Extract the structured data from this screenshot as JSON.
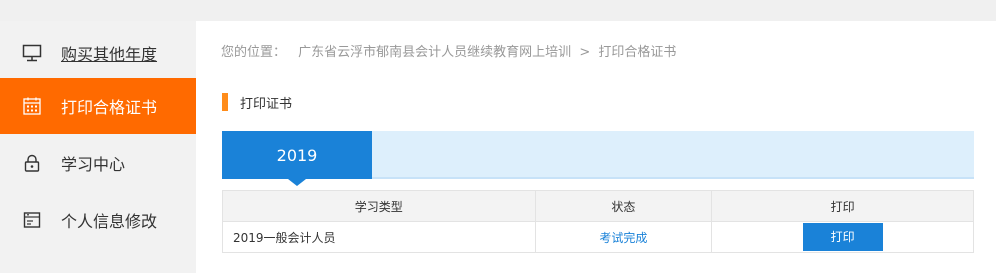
{
  "sidebar": {
    "items": [
      {
        "label": "购买其他年度",
        "icon": "monitor-icon"
      },
      {
        "label": "打印合格证书",
        "icon": "calendar-icon"
      },
      {
        "label": "学习中心",
        "icon": "lock-icon"
      },
      {
        "label": "个人信息修改",
        "icon": "id-card-icon"
      }
    ]
  },
  "breadcrumb": {
    "prefix": "您的位置：",
    "site": "广东省云浮市郁南县会计人员继续教育网上培训",
    "separator": ">",
    "current": "打印合格证书"
  },
  "section": {
    "title": "打印证书"
  },
  "year_tabs": {
    "active": "2019"
  },
  "table": {
    "headers": [
      "学习类型",
      "状态",
      "打印"
    ],
    "rows": [
      {
        "type": "2019一般会计人员",
        "status": "考试完成",
        "action": "打印"
      }
    ]
  },
  "colors": {
    "active_sidebar": "#ff6a00",
    "primary_blue": "#1a82d8",
    "title_bar": "#ff8c1a"
  }
}
